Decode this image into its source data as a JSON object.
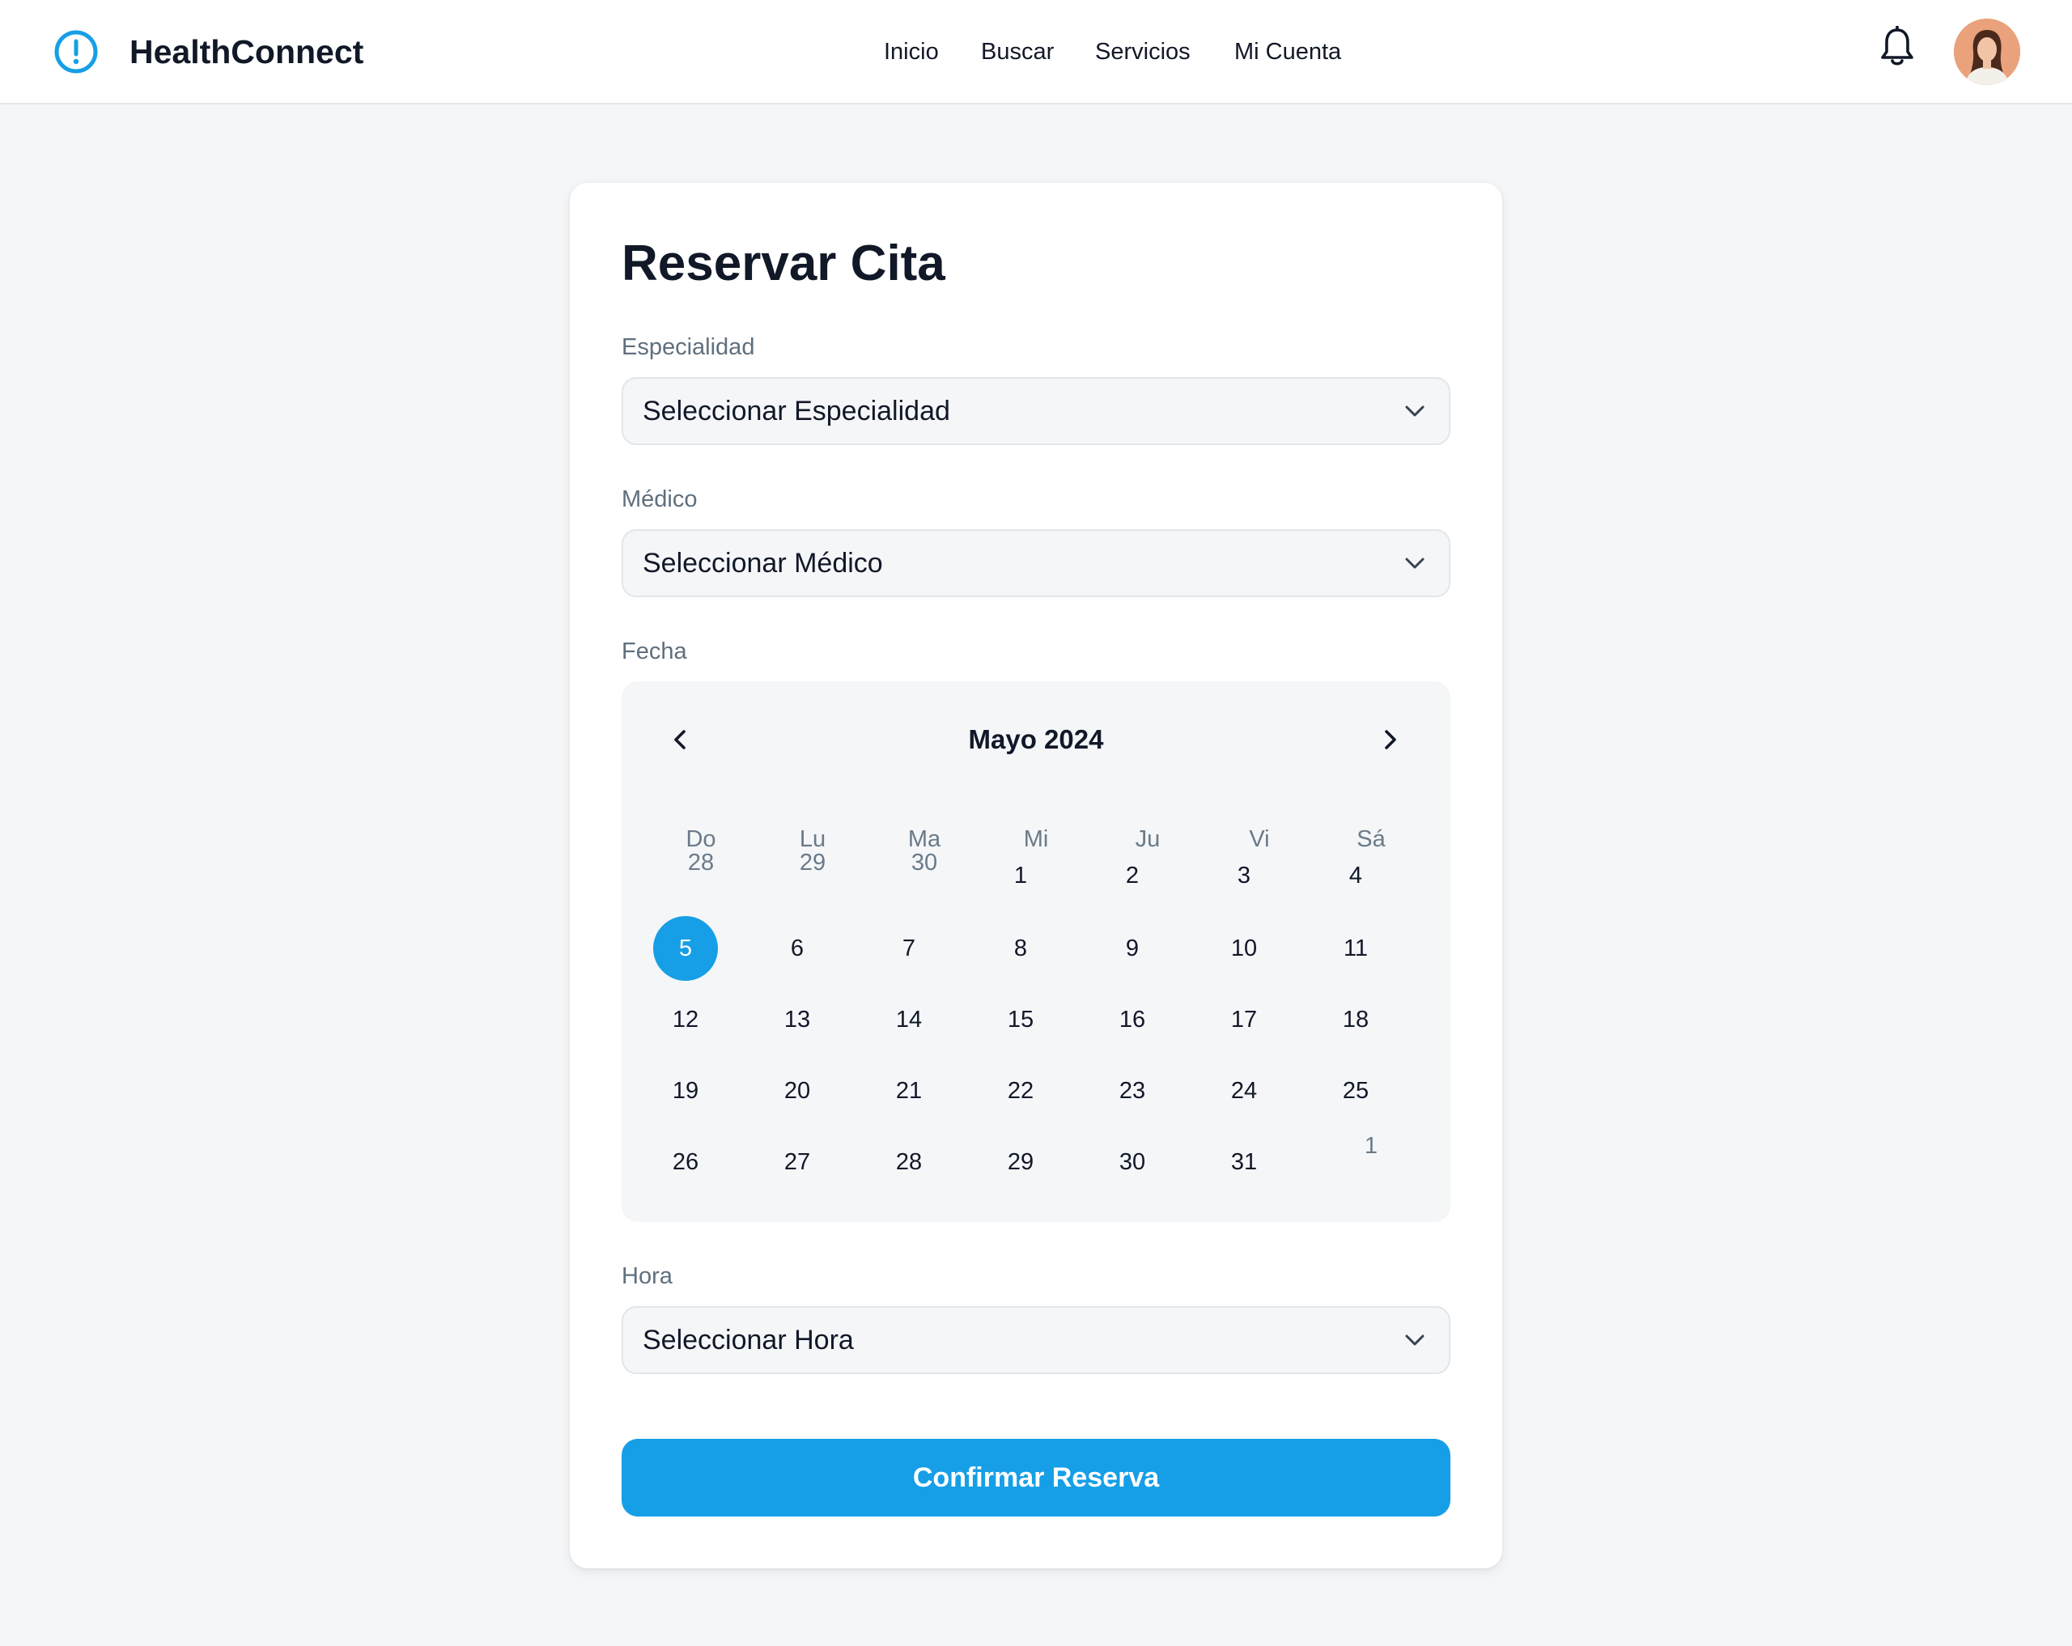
{
  "app": {
    "name": "HealthConnect"
  },
  "nav": {
    "items": [
      "Inicio",
      "Buscar",
      "Servicios",
      "Mi Cuenta"
    ]
  },
  "icons": {
    "logo": "alert-circle-icon",
    "notifications": "bell-icon",
    "chevron": "chevron-down-icon",
    "prev": "chevron-left-icon",
    "next": "chevron-right-icon"
  },
  "colors": {
    "accent": "#169fe6",
    "text": "#111827",
    "muted": "#6b7a88",
    "background": "#f4f6f8"
  },
  "form": {
    "title": "Reservar Cita",
    "specialty": {
      "label": "Especialidad",
      "value": "Seleccionar Especialidad"
    },
    "doctor": {
      "label": "Médico",
      "value": "Seleccionar Médico"
    },
    "date": {
      "label": "Fecha"
    },
    "time": {
      "label": "Hora",
      "value": "Seleccionar Hora"
    },
    "submit_label": "Confirmar Reserva"
  },
  "calendar": {
    "month_label": "Mayo 2024",
    "weekdays": [
      "Do",
      "Lu",
      "Ma",
      "Mi",
      "Ju",
      "Vi",
      "Sá"
    ],
    "selected_day": "5",
    "weeks": [
      [
        {
          "d": "28",
          "muted": true
        },
        {
          "d": "29",
          "muted": true
        },
        {
          "d": "30",
          "muted": true
        },
        {
          "d": "1"
        },
        {
          "d": "2"
        },
        {
          "d": "3"
        },
        {
          "d": "4"
        }
      ],
      [
        {
          "d": "5"
        },
        {
          "d": "6"
        },
        {
          "d": "7"
        },
        {
          "d": "8"
        },
        {
          "d": "9"
        },
        {
          "d": "10"
        },
        {
          "d": "11"
        }
      ],
      [
        {
          "d": "12"
        },
        {
          "d": "13"
        },
        {
          "d": "14"
        },
        {
          "d": "15"
        },
        {
          "d": "16"
        },
        {
          "d": "17"
        },
        {
          "d": "18"
        }
      ],
      [
        {
          "d": "19"
        },
        {
          "d": "20"
        },
        {
          "d": "21"
        },
        {
          "d": "22"
        },
        {
          "d": "23"
        },
        {
          "d": "24"
        },
        {
          "d": "25"
        }
      ],
      [
        {
          "d": "26"
        },
        {
          "d": "27"
        },
        {
          "d": "28"
        },
        {
          "d": "29"
        },
        {
          "d": "30"
        },
        {
          "d": "31"
        },
        {
          "d": "1",
          "muted": true
        }
      ]
    ]
  }
}
